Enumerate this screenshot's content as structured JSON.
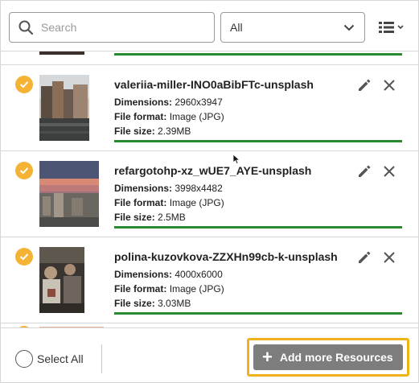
{
  "search": {
    "placeholder": "Search",
    "icon": "search-icon"
  },
  "filter": {
    "selected": "All",
    "icon": "chevron-down-icon"
  },
  "view_toggle": {
    "icon": "list-view-icon"
  },
  "resources": [
    {
      "name": "valeriia-miller-INO0aBibFTc-unsplash",
      "dimensions_label": "Dimensions:",
      "dimensions": "2960x3947",
      "format_label": "File format:",
      "format": "Image (JPG)",
      "size_label": "File size:",
      "size": "2.39MB",
      "selected": true,
      "upload_progress": 1.0
    },
    {
      "name": "refargotohp-xz_wUE7_AYE-unsplash",
      "dimensions_label": "Dimensions:",
      "dimensions": "3998x4482",
      "format_label": "File format:",
      "format": "Image (JPG)",
      "size_label": "File size:",
      "size": "2.5MB",
      "selected": true,
      "upload_progress": 1.0
    },
    {
      "name": "polina-kuzovkova-ZZXHn99cb-k-unsplash",
      "dimensions_label": "Dimensions:",
      "dimensions": "4000x6000",
      "format_label": "File format:",
      "format": "Image (JPG)",
      "size_label": "File size:",
      "size": "3.03MB",
      "selected": true,
      "upload_progress": 1.0
    }
  ],
  "footer": {
    "select_all_label": "Select All",
    "add_button_label": "Add more Resources"
  },
  "colors": {
    "accent_check": "#f5b335",
    "progress": "#2a8a2f",
    "highlight": "#f0b21a",
    "button": "#7d7d7d"
  }
}
